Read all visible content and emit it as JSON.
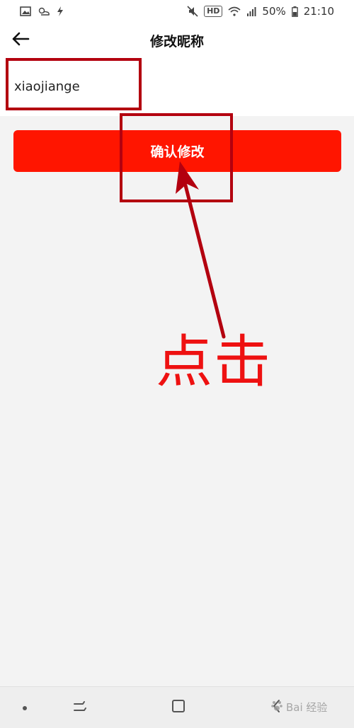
{
  "status_bar": {
    "battery_percent": "50%",
    "time": "21:10",
    "hd_badge": "HD",
    "left_icons": [
      "image-icon",
      "weather-icon",
      "flash-icon"
    ],
    "right_icons": [
      "mute-icon",
      "hd-icon",
      "wifi-icon",
      "signal-icon",
      "battery-icon"
    ]
  },
  "header": {
    "back_icon": "back-arrow-icon",
    "title": "修改昵称"
  },
  "nickname_field": {
    "value": "xiaojiange"
  },
  "confirm_button": {
    "label": "确认修改"
  },
  "annotation": {
    "text": "点击"
  },
  "nav_bar": {
    "items": [
      "dot-icon",
      "recent-apps-icon",
      "home-icon",
      "back-icon"
    ]
  },
  "watermark": {
    "text": "Bai 经验"
  },
  "colors": {
    "accent": "#ff1500",
    "highlight_box": "#b3000f",
    "annotation_text": "#ee1111",
    "page_bg": "#f3f3f3"
  }
}
